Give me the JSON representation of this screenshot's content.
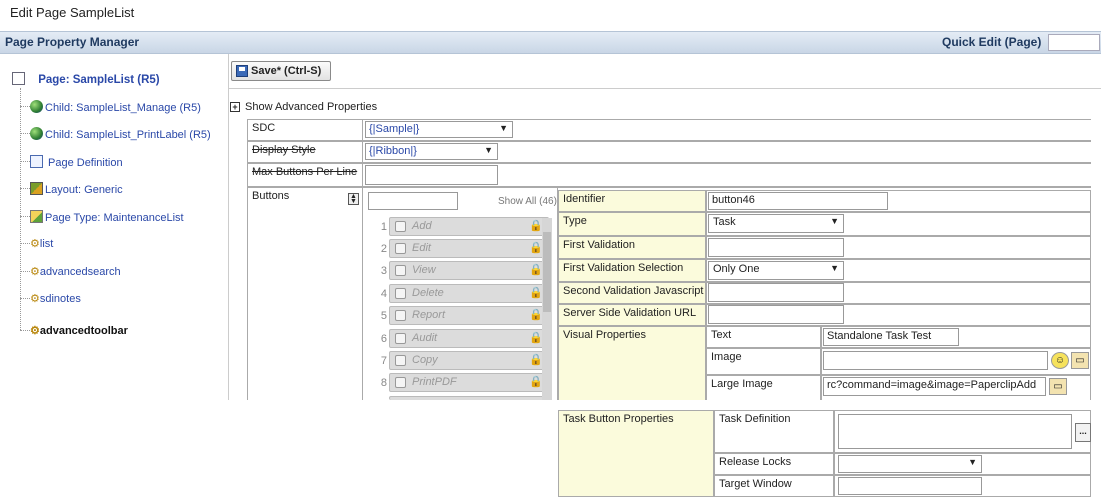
{
  "title": "Edit Page SampleList",
  "header": {
    "title": "Page Property Manager",
    "quick_edit_label": "Quick Edit (Page)"
  },
  "tree": [
    {
      "label": "Page: SampleList (R5)",
      "icon": "page-icon"
    },
    {
      "label": "Child: SampleList_Manage (R5)",
      "icon": "globe-icon"
    },
    {
      "label": "Child: SampleList_PrintLabel (R5)",
      "icon": "globe-icon"
    },
    {
      "label": "Page Definition",
      "icon": "document-icon"
    },
    {
      "label": "Layout: Generic",
      "icon": "layout-icon"
    },
    {
      "label": "Page Type: MaintenanceList",
      "icon": "page-type-icon"
    },
    {
      "label": "list",
      "icon": "gear-icon"
    },
    {
      "label": "advancedsearch",
      "icon": "gear-icon"
    },
    {
      "label": "sdinotes",
      "icon": "gear-icon"
    },
    {
      "label": "advancedtoolbar",
      "icon": "gear-icon"
    }
  ],
  "toolbar": {
    "save_label": "Save* (Ctrl-S)"
  },
  "advanced": {
    "toggle_label": "Show Advanced Properties",
    "toggle_symbol": "+"
  },
  "props": {
    "sdc_label": "SDC",
    "sdc_value": "{|Sample|}",
    "display_style_label": "Display Style",
    "display_style_value": "{|Ribbon|}",
    "max_buttons_label": "Max Buttons Per Line",
    "buttons_label": "Buttons"
  },
  "buttons_list": {
    "show_all": "Show All (46)",
    "items": [
      {
        "num": "1",
        "label": "Add"
      },
      {
        "num": "2",
        "label": "Edit"
      },
      {
        "num": "3",
        "label": "View"
      },
      {
        "num": "4",
        "label": "Delete"
      },
      {
        "num": "5",
        "label": "Report"
      },
      {
        "num": "6",
        "label": "Audit"
      },
      {
        "num": "7",
        "label": "Copy"
      },
      {
        "num": "8",
        "label": "PrintPDF"
      }
    ]
  },
  "details": {
    "identifier_label": "Identifier",
    "identifier_value": "button46",
    "type_label": "Type",
    "type_value": "Task",
    "first_validation_label": "First Validation",
    "first_validation_selection_label": "First Validation Selection",
    "first_validation_selection_value": "Only One",
    "second_validation_label": "Second Validation Javascript",
    "server_validation_label": "Server Side Validation URL",
    "visual_label": "Visual Properties",
    "text_label": "Text",
    "text_value": "Standalone Task Test",
    "image_label": "Image",
    "large_image_label": "Large Image",
    "large_image_value": "rc?command=image&image=PaperclipAdd"
  },
  "task": {
    "section_label": "Task Button Properties",
    "task_definition_label": "Task Definition",
    "ellipsis": "...",
    "release_locks_label": "Release Locks",
    "target_window_label": "Target Window"
  }
}
